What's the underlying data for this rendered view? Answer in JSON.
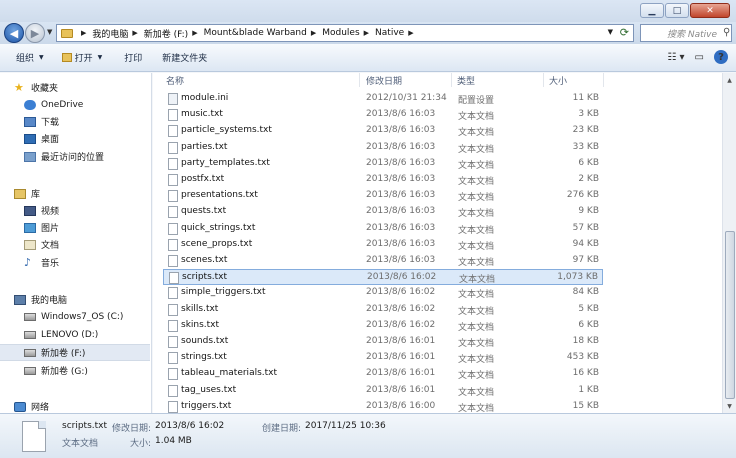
{
  "window": {
    "controls": {
      "minimize": "▁",
      "maximize": "□",
      "close": "✕"
    }
  },
  "address": {
    "crumbs": [
      "我的电脑",
      "新加卷 (F:)",
      "Mount&blade Warband",
      "Modules",
      "Native"
    ],
    "search_placeholder": "搜索 Native"
  },
  "toolbar": {
    "organize": "组织",
    "open": "打开",
    "print": "打印",
    "new_folder": "新建文件夹"
  },
  "nav": {
    "favorites": "收藏夹",
    "onedrive": "OneDrive",
    "downloads": "下载",
    "desktop": "桌面",
    "recent": "最近访问的位置",
    "libraries": "库",
    "videos": "视频",
    "pictures": "图片",
    "documents": "文档",
    "music": "音乐",
    "computer": "我的电脑",
    "drive_c": "Windows7_OS (C:)",
    "drive_d": "LENOVO (D:)",
    "drive_f": "新加卷 (F:)",
    "drive_g": "新加卷 (G:)",
    "network": "网络"
  },
  "columns": {
    "name": "名称",
    "date": "修改日期",
    "type": "类型",
    "size": "大小"
  },
  "files": [
    {
      "name": "module.ini",
      "date": "2012/10/31 21:34",
      "type": "配置设置",
      "size": "11 KB"
    },
    {
      "name": "music.txt",
      "date": "2013/8/6 16:03",
      "type": "文本文档",
      "size": "3 KB"
    },
    {
      "name": "particle_systems.txt",
      "date": "2013/8/6 16:03",
      "type": "文本文档",
      "size": "23 KB"
    },
    {
      "name": "parties.txt",
      "date": "2013/8/6 16:03",
      "type": "文本文档",
      "size": "33 KB"
    },
    {
      "name": "party_templates.txt",
      "date": "2013/8/6 16:03",
      "type": "文本文档",
      "size": "6 KB"
    },
    {
      "name": "postfx.txt",
      "date": "2013/8/6 16:03",
      "type": "文本文档",
      "size": "2 KB"
    },
    {
      "name": "presentations.txt",
      "date": "2013/8/6 16:03",
      "type": "文本文档",
      "size": "276 KB"
    },
    {
      "name": "quests.txt",
      "date": "2013/8/6 16:03",
      "type": "文本文档",
      "size": "9 KB"
    },
    {
      "name": "quick_strings.txt",
      "date": "2013/8/6 16:03",
      "type": "文本文档",
      "size": "57 KB"
    },
    {
      "name": "scene_props.txt",
      "date": "2013/8/6 16:03",
      "type": "文本文档",
      "size": "94 KB"
    },
    {
      "name": "scenes.txt",
      "date": "2013/8/6 16:03",
      "type": "文本文档",
      "size": "97 KB"
    },
    {
      "name": "scripts.txt",
      "date": "2013/8/6 16:02",
      "type": "文本文档",
      "size": "1,073 KB"
    },
    {
      "name": "simple_triggers.txt",
      "date": "2013/8/6 16:02",
      "type": "文本文档",
      "size": "84 KB"
    },
    {
      "name": "skills.txt",
      "date": "2013/8/6 16:02",
      "type": "文本文档",
      "size": "5 KB"
    },
    {
      "name": "skins.txt",
      "date": "2013/8/6 16:02",
      "type": "文本文档",
      "size": "6 KB"
    },
    {
      "name": "sounds.txt",
      "date": "2013/8/6 16:01",
      "type": "文本文档",
      "size": "18 KB"
    },
    {
      "name": "strings.txt",
      "date": "2013/8/6 16:01",
      "type": "文本文档",
      "size": "453 KB"
    },
    {
      "name": "tableau_materials.txt",
      "date": "2013/8/6 16:01",
      "type": "文本文档",
      "size": "16 KB"
    },
    {
      "name": "tag_uses.txt",
      "date": "2013/8/6 16:01",
      "type": "文本文档",
      "size": "1 KB"
    },
    {
      "name": "triggers.txt",
      "date": "2013/8/6 16:00",
      "type": "文本文档",
      "size": "15 KB"
    }
  ],
  "details": {
    "name": "scripts.txt",
    "modified_label": "修改日期:",
    "modified": "2013/8/6 16:02",
    "created_label": "创建日期:",
    "created": "2017/11/25 10:36",
    "type": "文本文档",
    "size_label": "大小:",
    "size": "1.04 MB"
  },
  "colors": {
    "selection": "#dbe9f9",
    "selection_border": "#84acdd",
    "accent": "#2f6dc2"
  }
}
